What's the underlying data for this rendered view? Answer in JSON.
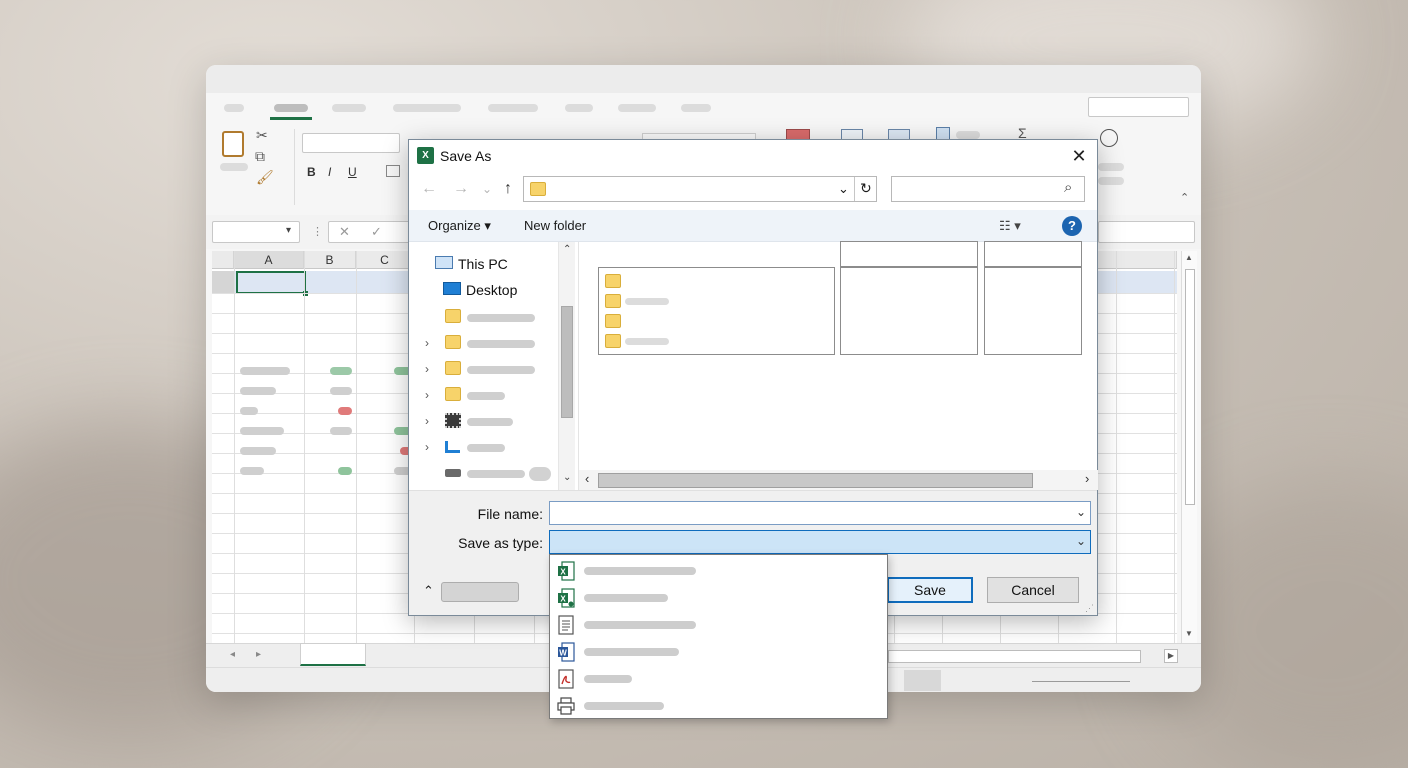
{
  "dialog": {
    "title": "Save As",
    "close_glyph": "✕",
    "app_icon_glyph": "X",
    "nav": {
      "back_glyph": "←",
      "forward_glyph": "→",
      "recent_glyph": "⌄",
      "up_glyph": "↑",
      "refresh_glyph": "↻",
      "address_dropdown_glyph": "⌄",
      "search_glyph": "⌕"
    },
    "commands": {
      "organize_label": "Organize ▾",
      "new_folder_label": "New folder",
      "view_glyph": "☷ ▾",
      "help_glyph": "?"
    },
    "tree": [
      {
        "label": "This PC",
        "icon": "monitor-icon"
      },
      {
        "label": "Desktop",
        "icon": "desktop-icon"
      }
    ],
    "file_name": {
      "label": "File name:",
      "value": ""
    },
    "save_as_type": {
      "label": "Save as type:",
      "value": ""
    },
    "buttons": {
      "save": "Save",
      "cancel": "Cancel",
      "hide_folders_glyph": "⌃"
    }
  },
  "save_type_options": [
    {
      "icon": "excel-workbook-icon"
    },
    {
      "icon": "excel-macro-workbook-icon"
    },
    {
      "icon": "text-document-icon"
    },
    {
      "icon": "word-document-icon"
    },
    {
      "icon": "pdf-icon"
    },
    {
      "icon": "printer-icon"
    }
  ],
  "excel": {
    "columns": [
      "A",
      "B",
      "C"
    ],
    "format_buttons": {
      "bold": "B",
      "italic": "I",
      "underline": "U"
    },
    "sum_glyph": "Σ",
    "cancel_glyph": "✕",
    "enter_glyph": "✓",
    "colors": {
      "accent_green": "#1e7145",
      "accent_blue": "#0f6cbd"
    }
  }
}
